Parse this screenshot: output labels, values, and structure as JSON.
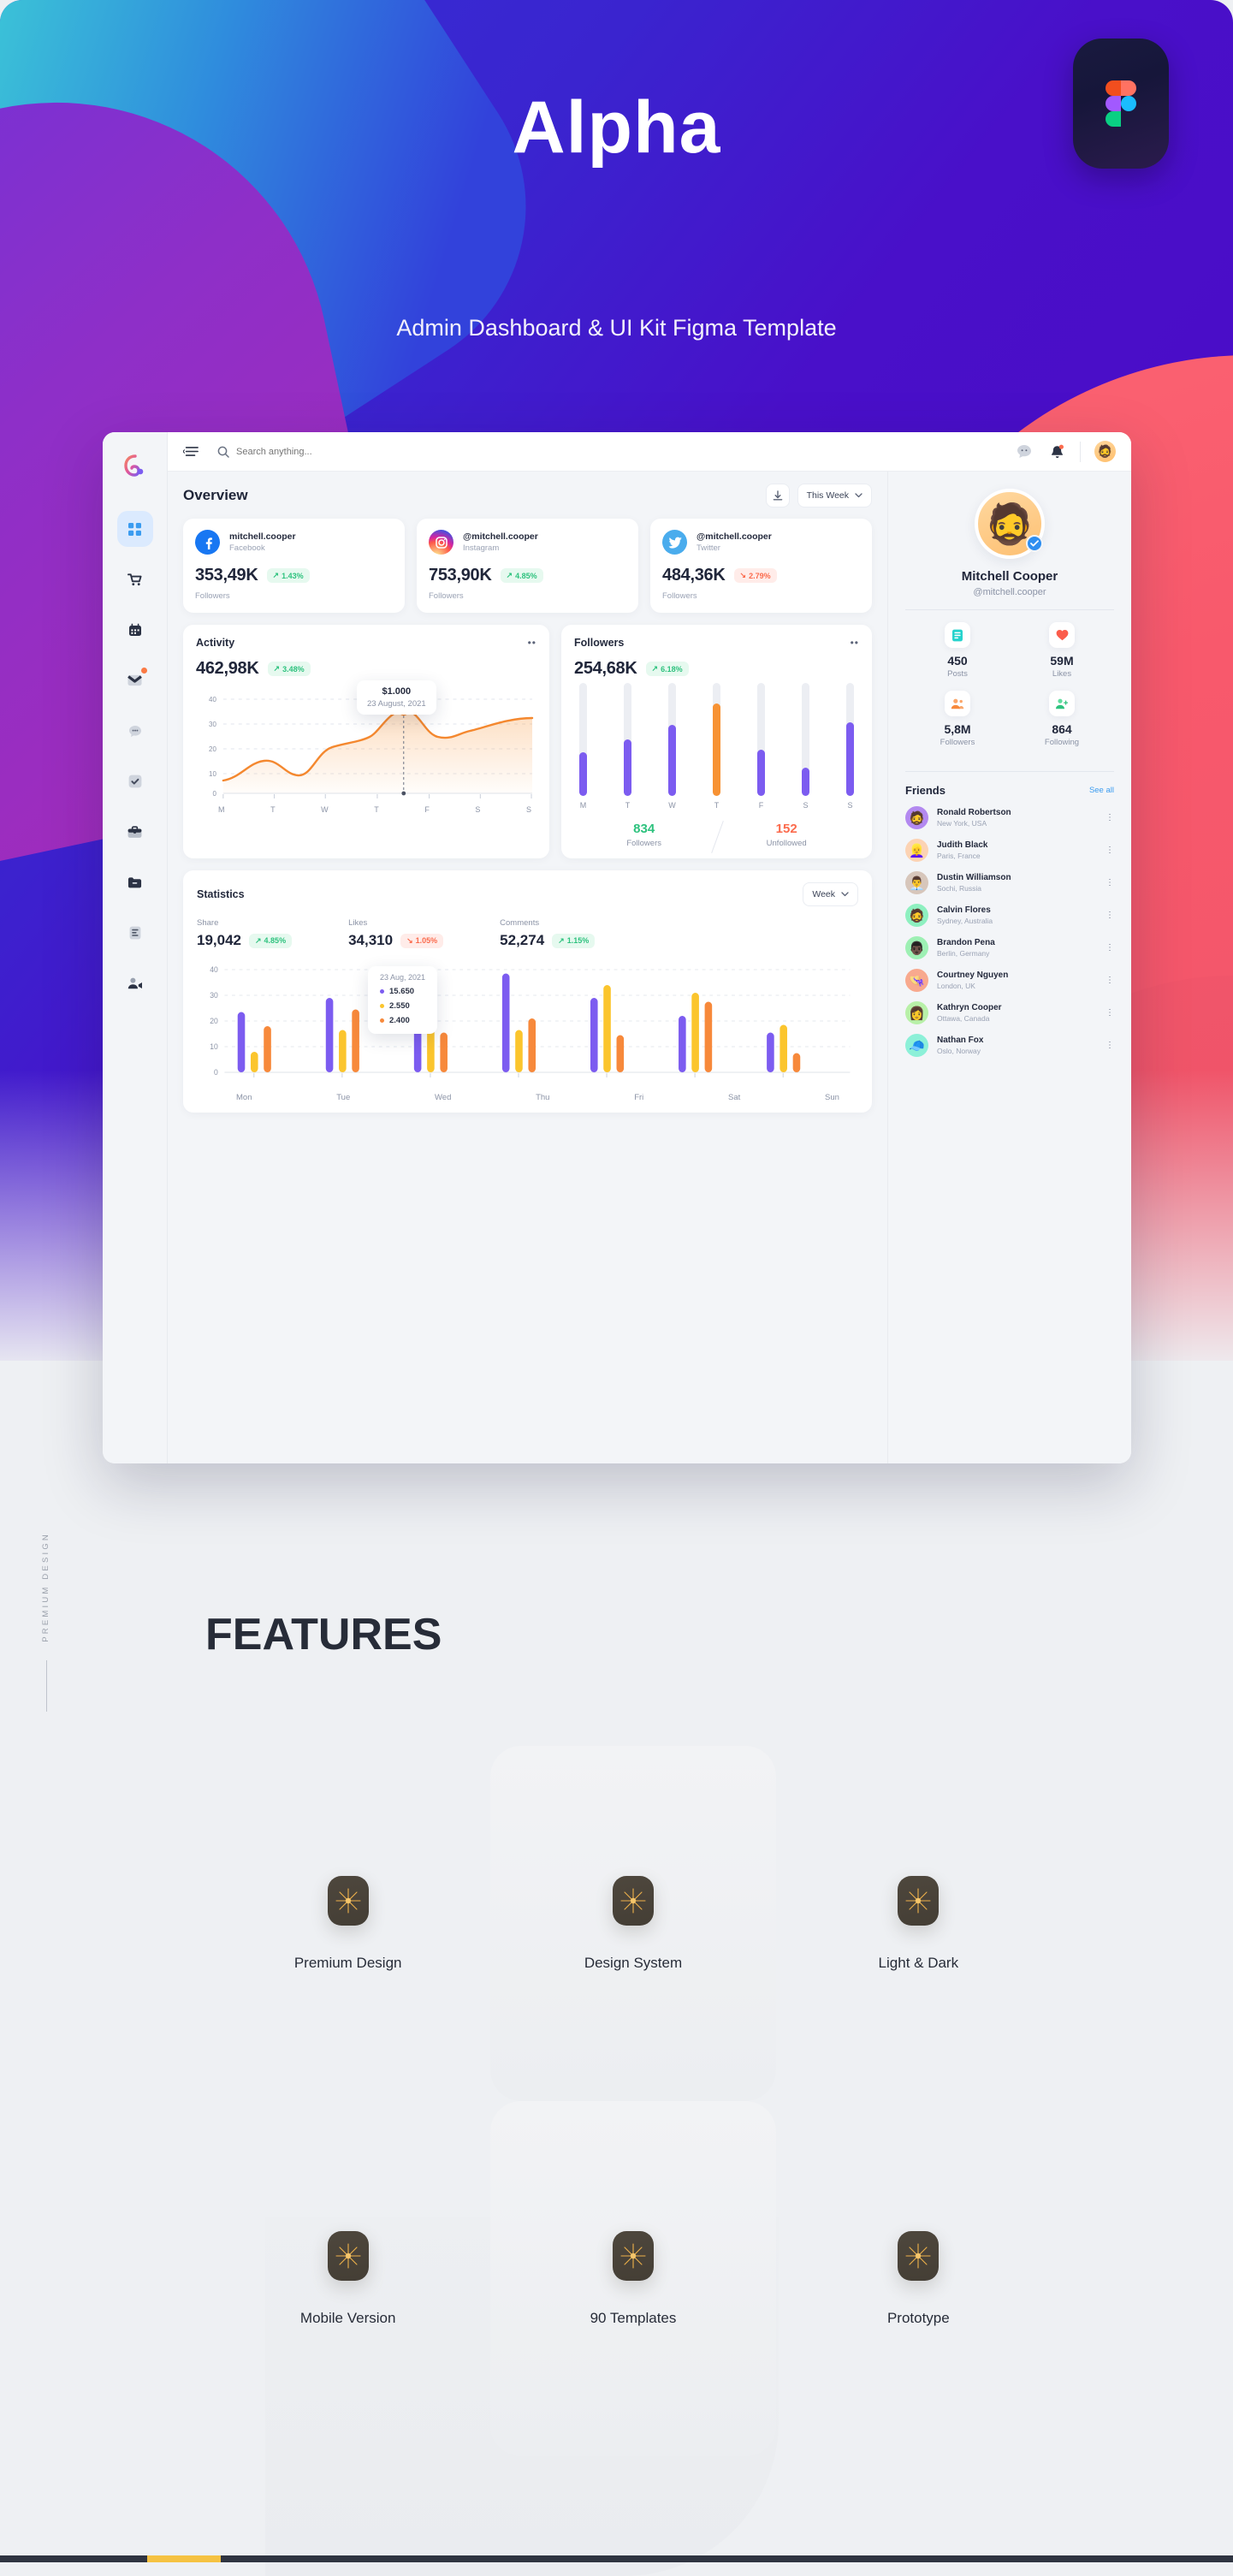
{
  "hero": {
    "title": "Alpha",
    "subtitle": "Admin Dashboard & UI Kit Figma Template",
    "badge_icon": "figma-icon"
  },
  "dashboard": {
    "logo_icon": "alpha-logo-icon",
    "rail_items": [
      {
        "icon": "grid-dashboard-icon",
        "active": true
      },
      {
        "icon": "cart-icon",
        "active": false
      },
      {
        "icon": "calendar-icon",
        "active": false
      },
      {
        "icon": "mail-icon",
        "active": false,
        "badge": true
      },
      {
        "icon": "chat-icon",
        "active": false
      },
      {
        "icon": "check-task-icon",
        "active": false
      },
      {
        "icon": "briefcase-icon",
        "active": false
      },
      {
        "icon": "folder-icon",
        "active": false
      },
      {
        "icon": "document-icon",
        "active": false
      },
      {
        "icon": "video-call-icon",
        "active": false
      }
    ],
    "topbar": {
      "menu_icon": "hamburger-collapse-icon",
      "search_icon": "search-icon",
      "search_placeholder": "Search anything...",
      "search_value": "",
      "chat_icon": "chat-bubble-icon",
      "notification_icon": "bell-icon",
      "avatar_icon": "user-avatar-icon",
      "avatar_emoji": "🧔"
    },
    "overview": {
      "title": "Overview",
      "download_icon": "download-icon",
      "range_label": "This Week",
      "range_caret_icon": "chevron-down-icon"
    },
    "social_cards": [
      {
        "icon": "facebook-icon",
        "name": "mitchell.cooper",
        "network": "Facebook",
        "value": "353,49K",
        "delta": "1.43%",
        "direction": "up",
        "arrow": "↗",
        "label": "Followers"
      },
      {
        "icon": "instagram-icon",
        "name": "@mitchell.cooper",
        "network": "Instagram",
        "value": "753,90K",
        "delta": "4.85%",
        "direction": "up",
        "arrow": "↗",
        "label": "Followers"
      },
      {
        "icon": "twitter-icon",
        "name": "@mitchell.cooper",
        "network": "Twitter",
        "value": "484,36K",
        "delta": "2.79%",
        "direction": "down",
        "arrow": "↘",
        "label": "Followers"
      }
    ],
    "activity": {
      "title": "Activity",
      "menu_icon": "more-horizontal-icon",
      "value": "462,98K",
      "delta": "3.48%",
      "direction": "up",
      "arrow": "↗",
      "tooltip_value": "$1.000",
      "tooltip_date": "23 August, 2021"
    },
    "followers": {
      "title": "Followers",
      "menu_icon": "more-horizontal-icon",
      "value": "254,68K",
      "delta": "6.18%",
      "direction": "up",
      "arrow": "↗",
      "followers_count": "834",
      "followers_caption": "Followers",
      "unfollowed_count": "152",
      "unfollowed_caption": "Unfollowed"
    },
    "statistics": {
      "title": "Statistics",
      "range_label": "Week",
      "range_caret_icon": "chevron-down-icon",
      "metrics": [
        {
          "label": "Share",
          "value": "19,042",
          "delta": "4.85%",
          "direction": "up",
          "arrow": "↗"
        },
        {
          "label": "Likes",
          "value": "34,310",
          "delta": "1.05%",
          "direction": "down",
          "arrow": "↘"
        },
        {
          "label": "Comments",
          "value": "52,274",
          "delta": "1.15%",
          "direction": "up",
          "arrow": "↗"
        }
      ],
      "tooltip_date": "23 Aug, 2021",
      "tooltip_items": [
        {
          "color": "#7c5cf0",
          "value": "15.650"
        },
        {
          "color": "#fbc52d",
          "value": "2.550"
        },
        {
          "color": "#f7893b",
          "value": "2.400"
        }
      ]
    },
    "profile": {
      "avatar_emoji": "🧔",
      "verified_icon": "verified-check-icon",
      "name": "Mitchell Cooper",
      "handle": "@mitchell.cooper",
      "stats": [
        {
          "icon": "posts-icon",
          "emoji": "📘",
          "value": "450",
          "label": "Posts"
        },
        {
          "icon": "likes-heart-icon",
          "emoji": "❤️",
          "value": "59M",
          "label": "Likes"
        },
        {
          "icon": "followers-icon",
          "emoji": "👥",
          "value": "5,8M",
          "label": "Followers"
        },
        {
          "icon": "following-icon",
          "emoji": "👤",
          "value": "864",
          "label": "Following"
        }
      ]
    },
    "friends": {
      "title": "Friends",
      "see_all": "See all",
      "more_icon": "more-vertical-icon",
      "items": [
        {
          "name": "Ronald Robertson",
          "location": "New York, USA",
          "emoji": "🧔",
          "bg": "#b389f0"
        },
        {
          "name": "Judith Black",
          "location": "Paris, France",
          "emoji": "👱‍♀️",
          "bg": "#fcd3b4"
        },
        {
          "name": "Dustin Williamson",
          "location": "Sochi, Russia",
          "emoji": "👨‍💼",
          "bg": "#d7c6bb"
        },
        {
          "name": "Calvin Flores",
          "location": "Sydney, Australia",
          "emoji": "🧔",
          "bg": "#8ef0c0"
        },
        {
          "name": "Brandon Pena",
          "location": "Berlin, Germany",
          "emoji": "👨🏿",
          "bg": "#9ef0b4"
        },
        {
          "name": "Courtney Nguyen",
          "location": "London, UK",
          "emoji": "👒",
          "bg": "#f8a98e"
        },
        {
          "name": "Kathryn Cooper",
          "location": "Ottawa, Canada",
          "emoji": "👩",
          "bg": "#b8f0a8"
        },
        {
          "name": "Nathan Fox",
          "location": "Oslo, Norway",
          "emoji": "🧢",
          "bg": "#8cf0d8"
        }
      ]
    }
  },
  "features": {
    "side_label": "PREMIUM DESIGN",
    "title": "FEATURES",
    "items": [
      {
        "label": "Premium Design",
        "icon": "sparkle-star-icon"
      },
      {
        "label": "Design System",
        "icon": "sparkle-star-icon"
      },
      {
        "label": "Light & Dark",
        "icon": "sparkle-star-icon"
      },
      {
        "label": "Mobile Version",
        "icon": "sparkle-star-icon"
      },
      {
        "label": "90 Templates",
        "icon": "sparkle-star-icon"
      },
      {
        "label": "Prototype",
        "icon": "sparkle-star-icon"
      }
    ]
  },
  "chart_data": [
    {
      "type": "area",
      "title": "Activity",
      "categories": [
        "M",
        "T",
        "W",
        "T",
        "F",
        "S",
        "S"
      ],
      "values": [
        5,
        12.5,
        7.5,
        17,
        33,
        19.5,
        28
      ],
      "xlabel": "",
      "ylabel": "",
      "ylim": [
        0,
        40
      ],
      "yticks": [
        0,
        10,
        20,
        30,
        40
      ],
      "grid": true,
      "legend": "none",
      "annotation": {
        "x": "F",
        "value": "$1.000",
        "date": "23 August, 2021"
      },
      "series_color": "#f4882f"
    },
    {
      "type": "bar",
      "title": "Followers",
      "categories": [
        "M",
        "T",
        "W",
        "T",
        "F",
        "S",
        "S"
      ],
      "values": [
        39,
        50,
        63,
        82,
        41,
        25,
        65
      ],
      "xlabel": "",
      "ylabel": "",
      "ylim": [
        0,
        100
      ],
      "grid": false,
      "legend": "none",
      "bar_color": "#7c5cf0",
      "highlight_index": 3,
      "highlight_color": "#f79233"
    },
    {
      "type": "bar",
      "title": "Statistics",
      "categories": [
        "Mon",
        "Tue",
        "Wed",
        "Thu",
        "Fri",
        "Sat",
        "Sun"
      ],
      "series": [
        {
          "name": "Share",
          "color": "#7c5cf0",
          "values": [
            23.5,
            29,
            19,
            38.5,
            29,
            22,
            15.5
          ]
        },
        {
          "name": "Likes",
          "color": "#fbc52d",
          "values": [
            8,
            16.5,
            18,
            16.5,
            34,
            31,
            18.5
          ]
        },
        {
          "name": "Comments",
          "color": "#f7893b",
          "values": [
            18,
            24.5,
            15.5,
            21,
            14.5,
            27.5,
            7.5
          ]
        }
      ],
      "xlabel": "",
      "ylabel": "",
      "ylim": [
        0,
        40
      ],
      "yticks": [
        0,
        10,
        20,
        30,
        40
      ],
      "grid": true,
      "legend": "tooltip",
      "annotation": {
        "date": "23 Aug, 2021",
        "values": [
          "15.650",
          "2.550",
          "2.400"
        ]
      }
    }
  ]
}
